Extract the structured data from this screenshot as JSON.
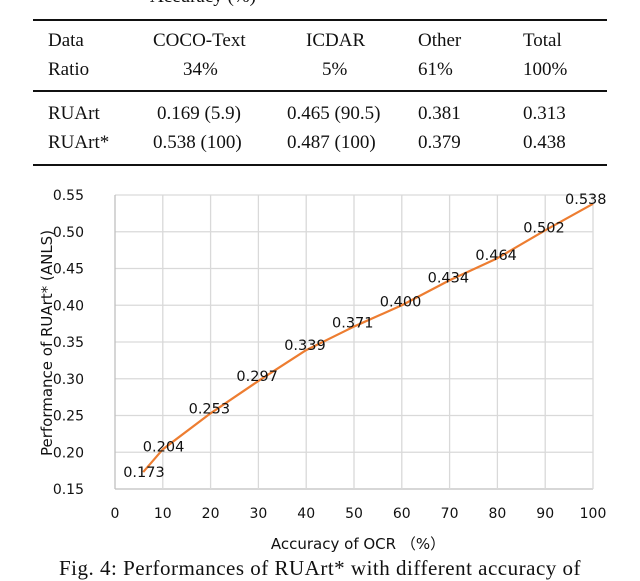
{
  "top_cut_text": "Accuracy (%)",
  "table": {
    "header": [
      "Data",
      "COCO-Text",
      "ICDAR",
      "Other",
      "Total"
    ],
    "ratio_row": [
      "Ratio",
      "34%",
      "5%",
      "61%",
      "100%"
    ],
    "rows": [
      [
        "RUArt",
        "0.169 (5.9)",
        "0.465 (90.5)",
        "0.381",
        "0.313"
      ],
      [
        "RUArt*",
        "0.538 (100)",
        "0.487 (100)",
        "0.379",
        "0.438"
      ]
    ]
  },
  "chart_data": {
    "type": "line",
    "title": "",
    "xlabel": "Accuracy of OCR （%）",
    "ylabel": "Performance of RUArt*  (ANLS)",
    "x": [
      5.9,
      10,
      20,
      30,
      40,
      50,
      60,
      70,
      80,
      90,
      100
    ],
    "series": [
      {
        "name": "RUArt*",
        "color": "#ed7d31",
        "values": [
          0.173,
          0.204,
          0.253,
          0.297,
          0.339,
          0.371,
          0.4,
          0.434,
          0.464,
          0.502,
          0.538
        ]
      }
    ],
    "data_labels": [
      "0.173",
      "0.204",
      "0.253",
      "0.297",
      "0.339",
      "0.371",
      "0.400",
      "0.434",
      "0.464",
      "0.502",
      "0.538"
    ],
    "xlim": [
      0,
      100
    ],
    "ylim": [
      0.15,
      0.55
    ],
    "xticks": [
      "0",
      "10",
      "20",
      "30",
      "40",
      "50",
      "60",
      "70",
      "80",
      "90",
      "100"
    ],
    "yticks": [
      "0.15",
      "0.20",
      "0.25",
      "0.30",
      "0.35",
      "0.40",
      "0.45",
      "0.50",
      "0.55"
    ],
    "grid": true,
    "legend": "none",
    "colors": {
      "line": "#ed7d31",
      "grid": "#d9d9d9",
      "text": "#111111"
    }
  },
  "caption": "Fig. 4: Performances of RUArt* with different accuracy of"
}
